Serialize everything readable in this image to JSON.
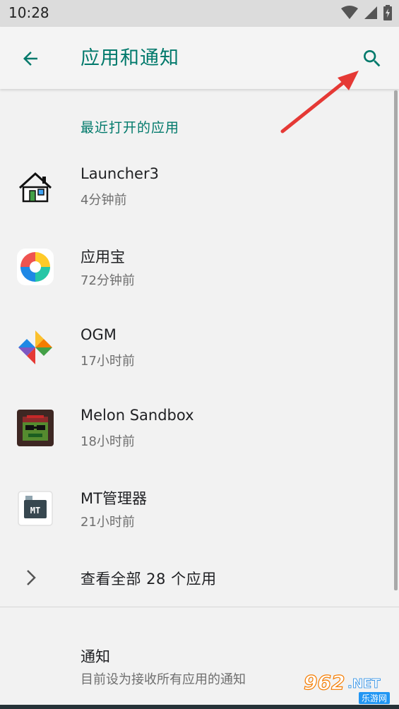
{
  "status_bar": {
    "time": "10:28",
    "icons": [
      "wifi-icon",
      "signal-icon",
      "battery-icon"
    ]
  },
  "app_bar": {
    "back_icon": "arrow-back-icon",
    "title": "应用和通知",
    "search_icon": "search-icon"
  },
  "colors": {
    "accent": "#00796b",
    "background": "#f2f2f2",
    "status_bar": "#dcdcdc",
    "annotation_arrow": "#e53935"
  },
  "recent_section": {
    "header": "最近打开的应用",
    "apps": [
      {
        "name": "Launcher3",
        "time": "4分钟前",
        "icon": "launcher3-icon"
      },
      {
        "name": "应用宝",
        "time": "72分钟前",
        "icon": "yingyongbao-icon"
      },
      {
        "name": "OGM",
        "time": "17小时前",
        "icon": "ogm-pinwheel-icon"
      },
      {
        "name": "Melon Sandbox",
        "time": "18小时前",
        "icon": "melon-sandbox-icon"
      },
      {
        "name": "MT管理器",
        "time": "21小时前",
        "icon": "mt-manager-icon"
      }
    ]
  },
  "see_all": {
    "label": "查看全部 28 个应用",
    "icon": "chevron-right-icon"
  },
  "notifications": {
    "title": "通知",
    "subtitle": "目前设为接收所有应用的通知"
  },
  "watermark": {
    "logo": "962.NET",
    "text": "乐游网"
  }
}
